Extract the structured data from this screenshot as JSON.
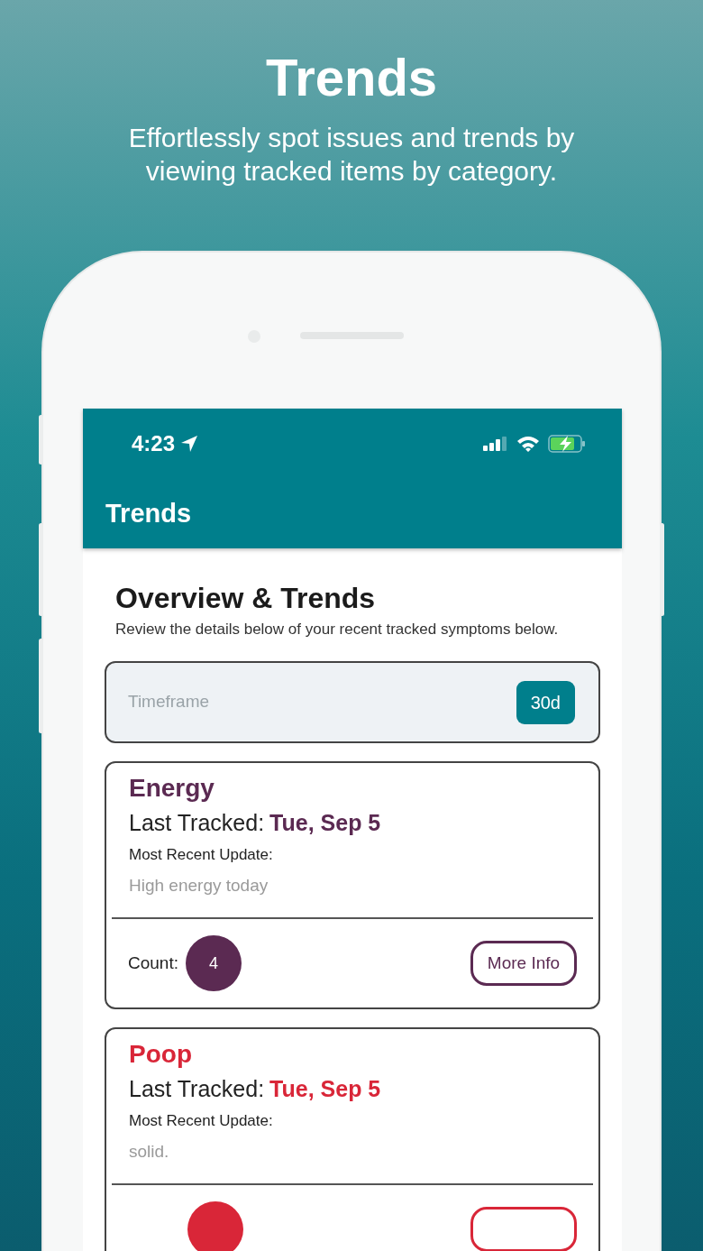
{
  "banner": {
    "title": "Trends",
    "subtitle": "Effortlessly spot issues and trends by viewing tracked items by category."
  },
  "status_bar": {
    "time": "4:23"
  },
  "app_bar": {
    "title": "Trends"
  },
  "overview": {
    "title": "Overview & Trends",
    "description": "Review the details below of your recent tracked symptoms below."
  },
  "timeframe": {
    "placeholder": "Timeframe",
    "button": "30d"
  },
  "cards": [
    {
      "name": "Energy",
      "color": "#5b2a52",
      "last_tracked_label": "Last Tracked:",
      "last_tracked": "Tue, Sep 5",
      "update_label": "Most Recent Update:",
      "update": "High energy today",
      "count_label": "Count:",
      "count": "4",
      "button": "More Info"
    },
    {
      "name": "Poop",
      "color": "#d92638",
      "last_tracked_label": "Last Tracked:",
      "last_tracked": "Tue, Sep 5",
      "update_label": "Most Recent Update:",
      "update": "solid."
    }
  ]
}
